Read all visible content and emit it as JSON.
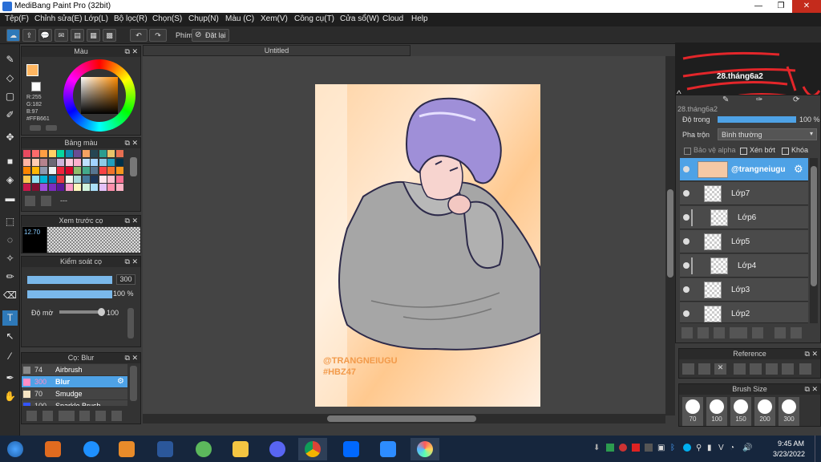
{
  "window": {
    "title": "MediBang Paint Pro (32bit)",
    "controls": [
      "—",
      "❐",
      "✕"
    ]
  },
  "menu": [
    "Tệp(F)",
    "Chỉnh sửa(E)",
    "Lớp(L)",
    "Bộ lọc(R)",
    "Chọn(S)",
    "Chụp(N)",
    "Màu (C)",
    "Xem(V)",
    "Công cụ(T)",
    "Cửa sổ(W)",
    "Cloud",
    "Help"
  ],
  "toolbar": {
    "shortcut_label": "Phím",
    "reset_label": "Đặt lại"
  },
  "document": {
    "tab_title": "Untitled"
  },
  "color_panel": {
    "title": "Màu",
    "r": "R:255",
    "g": "G:182",
    "b": "B:97",
    "hex": "#FFB661",
    "fg_color": "#FFB661"
  },
  "palette_panel": {
    "title": "Bảng màu",
    "extra": "---",
    "swatches": [
      "#e84a5f",
      "#ff6b6b",
      "#ff9f43",
      "#ffd166",
      "#06d6a0",
      "#118ab2",
      "#6a4c93",
      "#f4a261",
      "#264653",
      "#2a9d8f",
      "#e9c46a",
      "#e76f51",
      "#ffb4a2",
      "#ffcdb2",
      "#b5838d",
      "#6d6875",
      "#cdb4db",
      "#ffc8dd",
      "#ffafcc",
      "#bde0fe",
      "#a2d2ff",
      "#8ecae6",
      "#219ebc",
      "#023047",
      "#fb8500",
      "#ffb703",
      "#8d99ae",
      "#edf2f4",
      "#ef233c",
      "#d90429",
      "#90be6d",
      "#43aa8b",
      "#577590",
      "#f94144",
      "#f3722c",
      "#f8961e",
      "#f9c74f",
      "#90e0ef",
      "#00b4d8",
      "#0077b6",
      "#e63946",
      "#f1faee",
      "#a8dadc",
      "#457b9d",
      "#1d3557",
      "#ffe5ec",
      "#ffc2d1",
      "#fb6f92",
      "#c9184a",
      "#800f2f",
      "#9d4edd",
      "#7b2cbf",
      "#5a189a",
      "#ff99c8",
      "#fcf6bd",
      "#d0f4de",
      "#a9def9",
      "#e4c1f9",
      "#ff8fab",
      "#ffb3c6"
    ]
  },
  "preview_panel": {
    "title": "Xem trước cọ",
    "size": "12.70"
  },
  "brush_control": {
    "title": "Kiểm soát cọ",
    "size": "300",
    "opacity": "100 %",
    "blur_label": "Độ mờ",
    "blur_value": "100",
    "size_fill": 1.0,
    "opacity_fill": 1.0,
    "blur_fill": 1.0
  },
  "brush_list": {
    "title": "Cọ: Blur",
    "items": [
      {
        "size": "74",
        "name": "Airbrush",
        "color": "#888888"
      },
      {
        "size": "300",
        "name": "Blur",
        "color": "#ff8ec7"
      },
      {
        "size": "70",
        "name": "Smudge",
        "color": "#f5e4c3"
      },
      {
        "size": "100",
        "name": "Sparkle Brush",
        "color": "#3355ff"
      }
    ]
  },
  "layer_panel": {
    "header_name": "28.tháng6a2",
    "layer_name": "28.tháng6a2",
    "opacity_label": "Độ trong",
    "opacity_value": "100 %",
    "blend_label": "Pha trộn",
    "blend_value": "Bình thường",
    "protect_alpha": "Bảo vệ alpha",
    "clipping": "Xén bớt",
    "lock": "Khóa",
    "layers": [
      {
        "name": "@trangneiugu",
        "selected": true
      },
      {
        "name": "Lớp7",
        "selected": false
      },
      {
        "name": "Lớp6",
        "selected": false
      },
      {
        "name": "Lớp5",
        "selected": false
      },
      {
        "name": "Lớp4",
        "selected": false
      },
      {
        "name": "Lớp3",
        "selected": false
      },
      {
        "name": "Lớp2",
        "selected": false
      }
    ]
  },
  "reference_panel": {
    "title": "Reference"
  },
  "brush_size_panel": {
    "title": "Brush Size",
    "sizes": [
      "70",
      "100",
      "150",
      "200",
      "300"
    ]
  },
  "artwork": {
    "signature_line1": "@TRANGNEIUGU",
    "signature_line2": "#HBZ47"
  },
  "taskbar": {
    "time": "9:45 AM",
    "date": "3/23/2022"
  }
}
